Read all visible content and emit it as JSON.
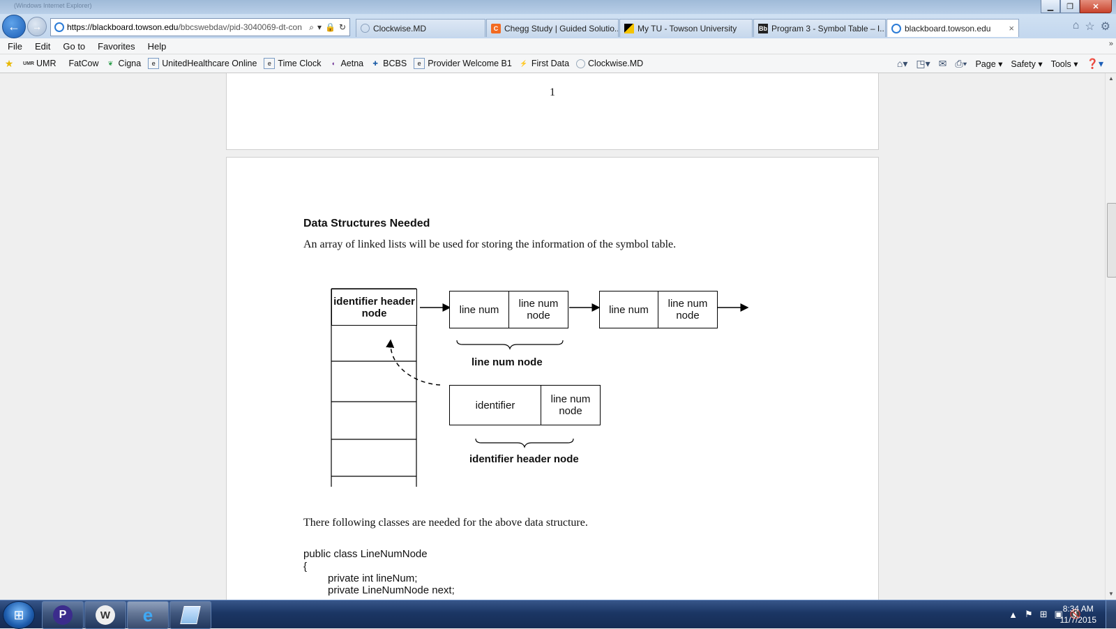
{
  "browser": {
    "ghost_title": "(Windows Internet Explorer)",
    "address_prefix": "https://",
    "address_domain": "blackboard.towson.edu",
    "address_path": "/bbcswebdav/pid-3040069-dt-con",
    "tabs": [
      {
        "label": "Clockwise.MD",
        "icon": "clock-icon",
        "active": false
      },
      {
        "label": "Chegg Study | Guided Solutio...",
        "icon": "chegg-icon",
        "active": false
      },
      {
        "label": "My TU - Towson University",
        "icon": "towson-flag-icon",
        "active": false
      },
      {
        "label": "Program 3 - Symbol Table – I...",
        "icon": "blackboard-icon",
        "active": false
      },
      {
        "label": "blackboard.towson.edu",
        "icon": "ie-page-icon",
        "active": true
      }
    ],
    "tab_close": "×"
  },
  "menu": [
    "File",
    "Edit",
    "Go to",
    "Favorites",
    "Help"
  ],
  "favorites": [
    {
      "label": "UMR",
      "icon": "umr-icon"
    },
    {
      "label": "FatCow",
      "icon": ""
    },
    {
      "label": "Cigna",
      "icon": "cigna-tree-icon"
    },
    {
      "label": "UnitedHealthcare Online",
      "icon": "ie-page-icon"
    },
    {
      "label": "Time Clock",
      "icon": "ie-page-icon"
    },
    {
      "label": "Aetna",
      "icon": "aetna-icon"
    },
    {
      "label": "BCBS",
      "icon": "bcbs-icon"
    },
    {
      "label": "Provider Welcome B1",
      "icon": "ie-page-icon"
    },
    {
      "label": "First Data",
      "icon": "first-data-icon"
    },
    {
      "label": "Clockwise.MD",
      "icon": "clock-icon"
    }
  ],
  "command_bar": {
    "page": "Page",
    "safety": "Safety",
    "tools": "Tools"
  },
  "document": {
    "page_number": "1",
    "section_title": "Data Structures Needed",
    "intro": "An array of linked lists will be used for storing the information of the symbol table.",
    "diagram": {
      "header_cell": "identifier header node",
      "line_num": "line num",
      "line_num_node": "line num node",
      "identifier": "identifier",
      "label_line_num_node": "line num node",
      "label_identifier_header_node": "identifier header node"
    },
    "after": "There following classes are needed for the above data structure.",
    "code": [
      "public class LineNumNode",
      "{",
      "private int lineNum;",
      "private LineNumNode next;"
    ]
  },
  "taskbar": {
    "time": "8:34 AM",
    "date": "11/7/2015",
    "apps": [
      "pandora-icon",
      "wordpress-icon",
      "internet-explorer-icon",
      "notepad-icon"
    ]
  },
  "colors": {
    "accent": "#1a5db5",
    "taskbar": "#1b3664"
  }
}
